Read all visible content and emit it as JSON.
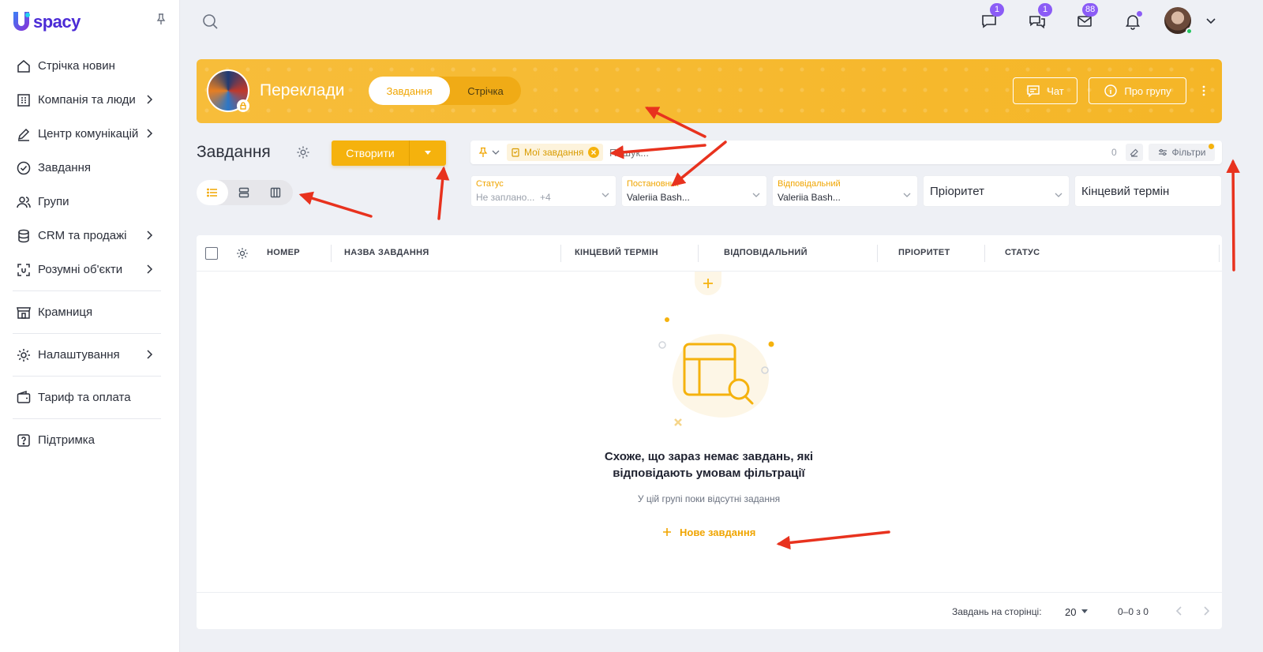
{
  "app": {
    "logo_text": "spacy",
    "logo_letter": "U"
  },
  "sidebar": {
    "items": [
      {
        "label": "Стрічка новин",
        "icon": "home-icon",
        "chevron": false
      },
      {
        "label": "Компанія та люди",
        "icon": "building-icon",
        "chevron": true
      },
      {
        "label": "Центр комунікацій",
        "icon": "edit-icon",
        "chevron": true
      },
      {
        "label": "Завдання",
        "icon": "check-circle-icon",
        "chevron": false
      },
      {
        "label": "Групи",
        "icon": "users-icon",
        "chevron": false
      },
      {
        "label": "CRM та продажі",
        "icon": "database-icon",
        "chevron": true
      },
      {
        "label": "Розумні об'єкти",
        "icon": "scan-icon",
        "chevron": true
      },
      {
        "label": "Крамниця",
        "icon": "store-icon",
        "chevron": false
      },
      {
        "label": "Налаштування",
        "icon": "gear-icon",
        "chevron": true
      },
      {
        "label": "Тариф та оплата",
        "icon": "wallet-icon",
        "chevron": false
      },
      {
        "label": "Підтримка",
        "icon": "help-icon",
        "chevron": false
      }
    ]
  },
  "topbar": {
    "chat_badge": "1",
    "messages_badge": "1",
    "mail_badge": "88"
  },
  "group": {
    "title": "Переклади",
    "tab_tasks": "Завдання",
    "tab_feed": "Стрічка",
    "chat_label": "Чат",
    "about_label": "Про групу"
  },
  "tasks": {
    "title": "Завдання",
    "create_label": "Створити"
  },
  "filters": {
    "chip_label": "Мої завдання",
    "search_placeholder": "Пошук...",
    "count": "0",
    "filters_label": "Фільтри",
    "status_label": "Статус",
    "status_value": "Не заплано...",
    "status_more": "+4",
    "creator_label": "Постановник",
    "creator_value": "Valeriia Bash...",
    "assignee_label": "Відповідальний",
    "assignee_value": "Valeriia Bash...",
    "priority_placeholder": "Пріоритет",
    "deadline_placeholder": "Кінцевий термін"
  },
  "table": {
    "columns": [
      "НОМЕР",
      "НАЗВА ЗАВДАННЯ",
      "КІНЦЕВИЙ ТЕРМІН",
      "ВІДПОВІДАЛЬНИЙ",
      "ПРІОРИТЕТ",
      "СТАТУС"
    ],
    "empty_title_line1": "Схоже, що зараз немає завдань, які",
    "empty_title_line2": "відповідають умовам фільтрації",
    "empty_subtitle": "У цій групі поки відсутні задання",
    "new_task_label": "Нове завдання"
  },
  "pagination": {
    "per_page_label": "Завдань на сторінці:",
    "per_page_value": "20",
    "range": "0–0 з 0"
  },
  "colors": {
    "accent": "#f5b20d",
    "brand": "#4b2bd6",
    "badge": "#8b5cf6",
    "annotation": "#e8321e"
  }
}
